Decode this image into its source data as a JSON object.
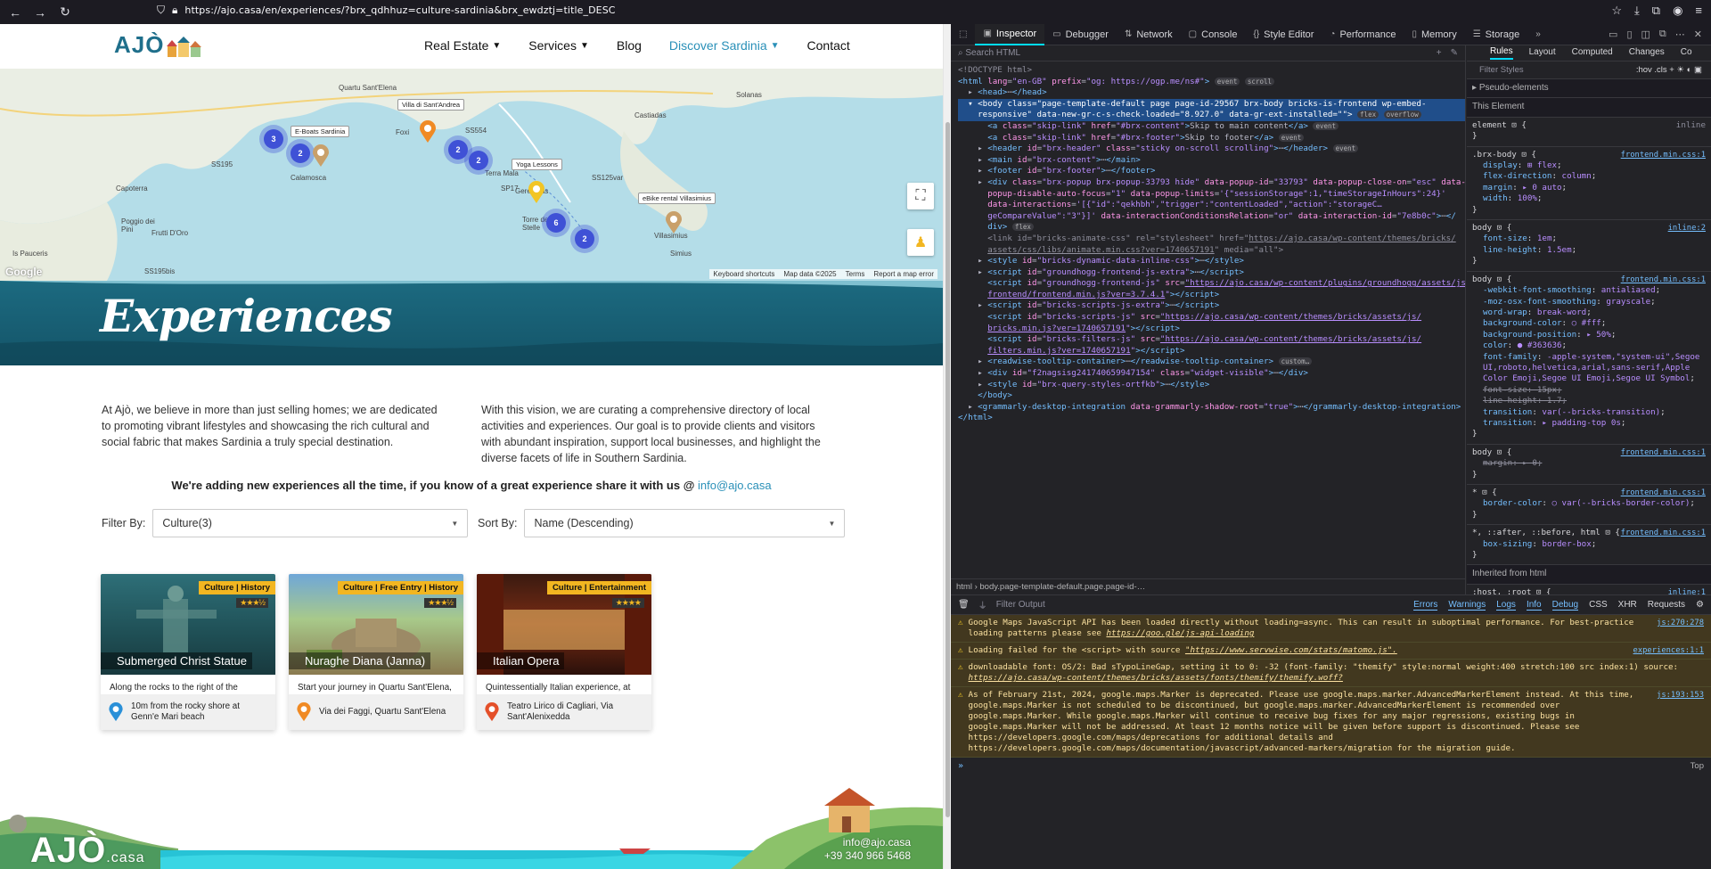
{
  "browser": {
    "url": "https://ajo.casa/en/experiences/?brx_qdhhuz=culture-sardinia&brx_ewdztj=title_DESC"
  },
  "site": {
    "logo_text": "AJÒ",
    "menu": [
      {
        "label": "Real Estate"
      },
      {
        "label": "Services"
      },
      {
        "label": "Blog"
      },
      {
        "label": "Discover Sardinia"
      },
      {
        "label": "Contact"
      }
    ]
  },
  "map": {
    "place_labels": [
      "Quartu Sant'Elena",
      "Capoterra",
      "Poggio dei Pini",
      "Frutti D'Oro",
      "Is Pauceris",
      "Calamosca",
      "Foxi",
      "Terra Mala",
      "Geremeas",
      "Torre delle Stelle",
      "Castiadas",
      "Villasimius",
      "Simius",
      "Solanas",
      "SS554",
      "SS195",
      "SS125var",
      "SP17",
      "SS195bis"
    ],
    "callouts": [
      "Villa di Sant'Andrea",
      "E-Boats Sardinia",
      "Yoga Lessons",
      "eBike rental Villasimius"
    ],
    "clusters": [
      "3",
      "2",
      "2",
      "2",
      "6",
      "2"
    ],
    "attribution": [
      "Keyboard shortcuts",
      "Map data ©2025",
      "Terms",
      "Report a map error"
    ],
    "google_logo": "Google"
  },
  "hero": {
    "title": "Experiences"
  },
  "intro": {
    "left": "At Ajò, we believe in more than just selling homes; we are dedicated to promoting vibrant lifestyles and showcasing the rich cultural and social fabric that makes Sardinia a truly special destination.",
    "right": "With this vision, we are curating a comprehensive directory of local activities and experiences. Our goal is to provide clients and visitors with abundant inspiration, support local businesses, and highlight the diverse facets of life in Southern Sardinia.",
    "share": "We're adding new experiences all the time, if you know of a great experience share it with us @",
    "email": "info@ajo.casa"
  },
  "filters": {
    "filter_label": "Filter By:",
    "filter_value": "Culture(3)",
    "sort_label": "Sort By:",
    "sort_value": "Name (Descending)"
  },
  "cards": [
    {
      "title": "Submerged Christ Statue",
      "tags": "Culture | History",
      "stars": "★★★½",
      "desc": "Along the rocks to the right of the Genn'e Mari beach in Torre Delle Stelle ...",
      "location": "10m from the rocky shore at Genn'e Mari beach",
      "pin_color": "#2a90d8"
    },
    {
      "title": "Nuraghe Diana (Janna)",
      "tags": "Culture | Free Entry | History",
      "stars": "★★★½",
      "desc": "Start your journey in Quartu Sant'Elena, where you can visit the Nuraghe Diana. It is ...",
      "location": "Via dei Faggi, Quartu Sant'Elena",
      "pin_color": "#f08a24"
    },
    {
      "title": "Italian Opera",
      "tags": "Culture | Entertainment",
      "stars": "★★★★",
      "desc": "Quintessentially Italian experience, at Teatro Lirico in Cagliari",
      "location": "Teatro Lirico di Cagliari, Via Sant'Alenixedda",
      "pin_color": "#e4502a"
    }
  ],
  "footer": {
    "logo": "AJÒ",
    "logo_suffix": ".casa",
    "email": "info@ajo.casa",
    "phone": "+39 340 966 5468"
  },
  "devtools": {
    "tabs": [
      "Inspector",
      "Debugger",
      "Network",
      "Console",
      "Style Editor",
      "Performance",
      "Memory",
      "Storage"
    ],
    "search_placeholder": "Search HTML",
    "breadcrumb": "html  ›  body.page-template-default.page.page-id-…",
    "rules_tabs": [
      "Rules",
      "Layout",
      "Computed",
      "Changes",
      "Co"
    ],
    "filter_styles": "Filter Styles",
    "pseudo": "Pseudo-elements",
    "this_element": "This Element",
    "inherited": "Inherited from html",
    "console_filter": "Filter Output",
    "console_levels": [
      "Errors",
      "Warnings",
      "Logs",
      "Info",
      "Debug",
      "CSS",
      "XHR",
      "Requests"
    ],
    "messages": [
      {
        "text": "Google Maps JavaScript API has been loaded directly without loading=async. This can result in suboptimal performance. For best-practice loading patterns please see ",
        "link": "https://goo.gle/js-api-loading",
        "loc": "js:270:278"
      },
      {
        "text": "Loading failed for the <script> with source ",
        "link": "\"https://www.servwise.com/stats/matomo.js\".",
        "loc": "experiences:1:1"
      },
      {
        "text": "downloadable font: OS/2: Bad sTypoLineGap, setting it to 0: -32 (font-family: \"themify\" style:normal weight:400 stretch:100 src index:1) source: ",
        "link": "https://ajo.casa/wp-content/themes/bricks/assets/fonts/themify/themify.woff?",
        "loc": ""
      },
      {
        "text": "As of February 21st, 2024, google.maps.Marker is deprecated. Please use google.maps.marker.AdvancedMarkerElement instead. At this time, google.maps.Marker is not scheduled to be discontinued, but google.maps.marker.AdvancedMarkerElement is recommended over google.maps.Marker. While google.maps.Marker will continue to receive bug fixes for any major regressions, existing bugs in google.maps.Marker will not be addressed. At least 12 months notice will be given before support is discontinued. Please see https://developers.google.com/maps/deprecations for additional details and https://developers.google.com/maps/documentation/javascript/advanced-markers/migration for the migration guide.",
        "link": "",
        "loc": "js:193:153"
      }
    ],
    "console_context": "Top"
  }
}
